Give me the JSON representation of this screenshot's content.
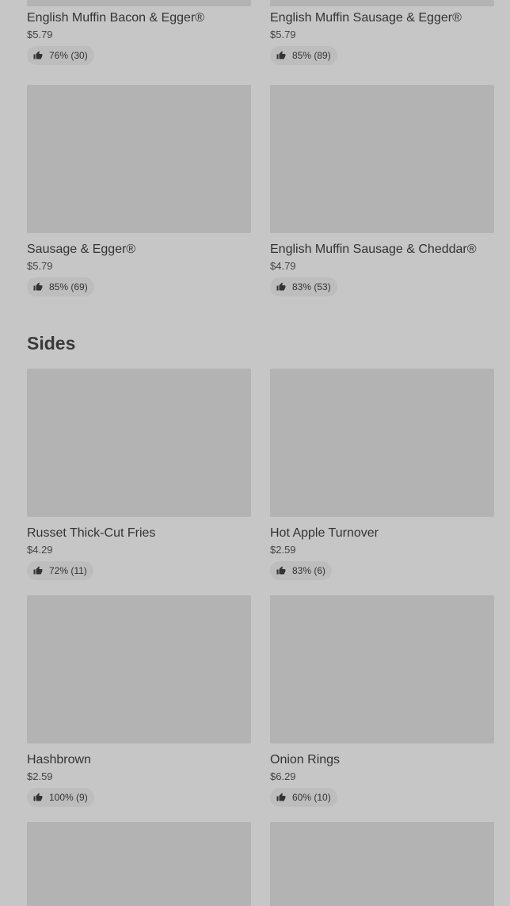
{
  "breakfast_items": [
    {
      "name": "English Muffin Bacon & Egger®",
      "price": "$5.79",
      "rating": "76% (30)"
    },
    {
      "name": "English Muffin Sausage & Egger®",
      "price": "$5.79",
      "rating": "85% (89)"
    },
    {
      "name": "Sausage & Egger®",
      "price": "$5.79",
      "rating": "85% (69)"
    },
    {
      "name": "English Muffin Sausage & Cheddar®",
      "price": "$4.79",
      "rating": "83% (53)"
    }
  ],
  "sides": {
    "title": "Sides",
    "items": [
      {
        "name": "Russet Thick-Cut Fries",
        "price": "$4.29",
        "rating": "72% (11)"
      },
      {
        "name": "Hot Apple Turnover",
        "price": "$2.59",
        "rating": "83% (6)"
      },
      {
        "name": "Hashbrown",
        "price": "$2.59",
        "rating": "100% (9)"
      },
      {
        "name": "Onion Rings",
        "price": "$6.29",
        "rating": "60% (10)"
      }
    ]
  },
  "icons": {
    "rating": "thumbs-up-icon"
  }
}
